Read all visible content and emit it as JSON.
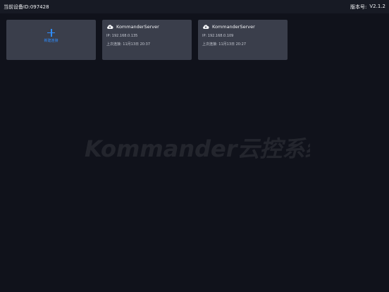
{
  "topbar": {
    "device_label": "当前设备ID:097428",
    "version_label": "版本号:",
    "version_value": "V2.1.2"
  },
  "add_card": {
    "label": "新建连接"
  },
  "servers": [
    {
      "name": "KommanderServer",
      "ip_label": "IP:",
      "ip": "192.168.0.135",
      "last_label": "上次连接:",
      "last": "11月13日 20:37"
    },
    {
      "name": "KommanderServer",
      "ip_label": "IP:",
      "ip": "192.168.0.109",
      "last_label": "上次连接:",
      "last": "11月13日 20:27"
    }
  ],
  "watermark": {
    "text": "Kommander云控系统"
  },
  "colors": {
    "background": "#10121b",
    "card": "#3a3e4b",
    "accent": "#2f8dff"
  },
  "icons": [
    "plus-icon",
    "cloud-icon"
  ]
}
